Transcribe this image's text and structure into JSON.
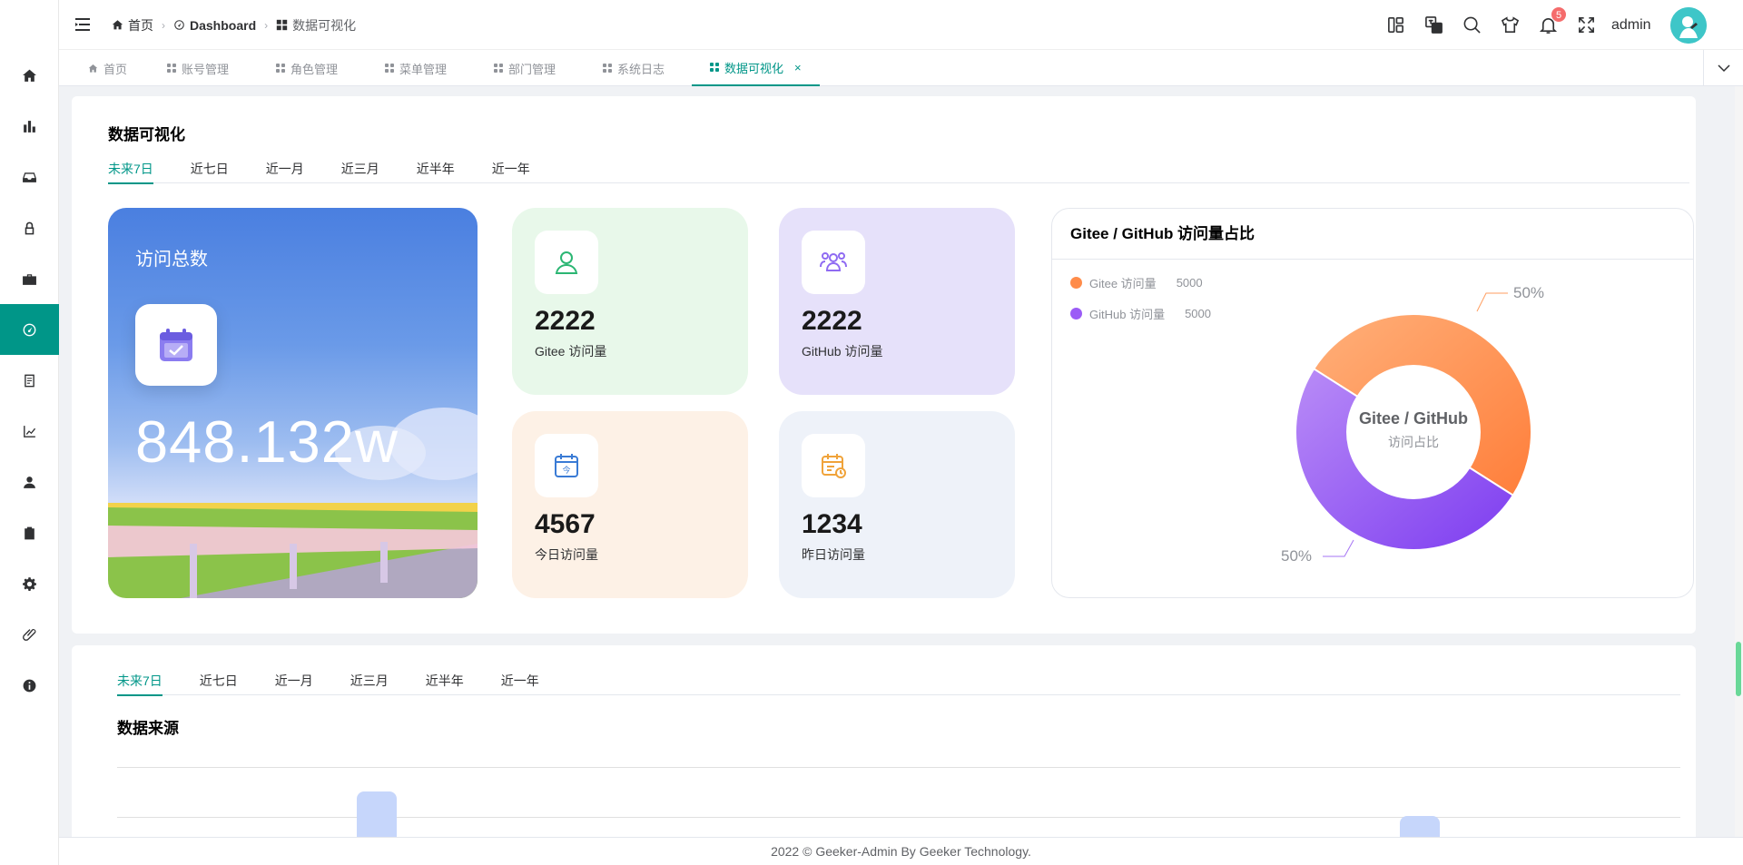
{
  "breadcrumb": [
    {
      "label": "首页",
      "icon": "home-icon"
    },
    {
      "label": "Dashboard",
      "icon": "dashboard-icon"
    },
    {
      "label": "数据可视化",
      "icon": "grid-icon"
    }
  ],
  "header": {
    "notification_count": "5",
    "username": "admin"
  },
  "tabs": [
    {
      "label": "首页",
      "icon": "home-icon"
    },
    {
      "label": "账号管理",
      "icon": "grid-icon"
    },
    {
      "label": "角色管理",
      "icon": "grid-icon"
    },
    {
      "label": "菜单管理",
      "icon": "grid-icon"
    },
    {
      "label": "部门管理",
      "icon": "grid-icon"
    },
    {
      "label": "系统日志",
      "icon": "grid-icon"
    },
    {
      "label": "数据可视化",
      "icon": "grid-icon",
      "active": true,
      "close": "×"
    }
  ],
  "main": {
    "title": "数据可视化",
    "time_tabs": [
      "未来7日",
      "近七日",
      "近一月",
      "近三月",
      "近半年",
      "近一年"
    ],
    "total": {
      "label": "访问总数",
      "value": "848.132w"
    },
    "stats": [
      {
        "value": "2222",
        "label": "Gitee 访问量"
      },
      {
        "value": "2222",
        "label": "GitHub 访问量"
      },
      {
        "value": "4567",
        "label": "今日访问量"
      },
      {
        "value": "1234",
        "label": "昨日访问量"
      }
    ],
    "pie": {
      "title": "Gitee / GitHub 访问量占比",
      "center_title": "Gitee / GitHub",
      "center_sub": "访问占比",
      "legend": [
        {
          "name": "Gitee 访问量",
          "value": "5000",
          "color": "#ff8c4a"
        },
        {
          "name": "GitHub 访问量",
          "value": "5000",
          "color": "#9b5cf6"
        }
      ],
      "label_top": "50%",
      "label_bottom": "50%"
    }
  },
  "chart_data": {
    "type": "pie",
    "categories": [
      "Gitee 访问量",
      "GitHub 访问量"
    ],
    "values": [
      5000,
      5000
    ],
    "title": "Gitee / GitHub 访问量占比"
  },
  "source": {
    "time_tabs": [
      "未来7日",
      "近七日",
      "近一月",
      "近三月",
      "近半年",
      "近一年"
    ],
    "title": "数据来源"
  },
  "footer": {
    "text": "2022 © Geeker-Admin By Geeker Technology."
  },
  "colors": {
    "accent": "#009688",
    "badge": "#f56c6c"
  }
}
